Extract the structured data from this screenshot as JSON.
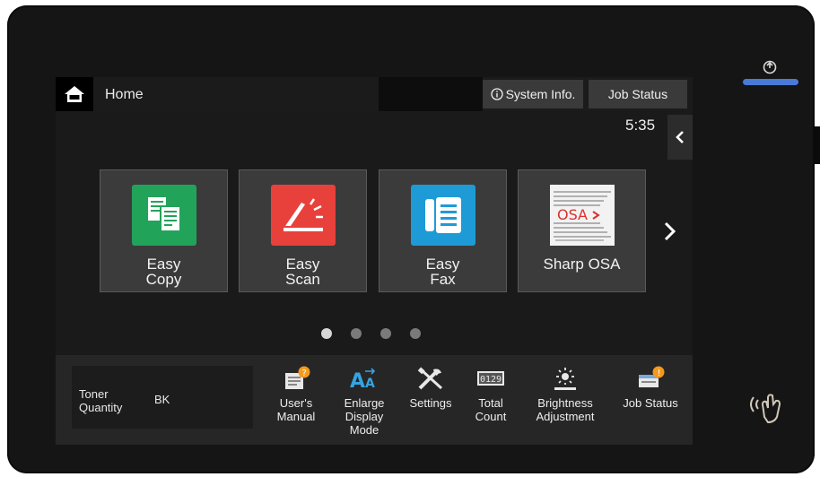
{
  "header": {
    "home_label": "Home",
    "system_info_label": "System Info.",
    "job_status_label": "Job Status",
    "clock": "5:35"
  },
  "tiles": [
    {
      "label_line1": "Easy",
      "label_line2": "Copy",
      "color": "#22a35a",
      "icon": "copy-icon"
    },
    {
      "label_line1": "Easy",
      "label_line2": "Scan",
      "color": "#e8413c",
      "icon": "scan-icon"
    },
    {
      "label_line1": "Easy",
      "label_line2": "Fax",
      "color": "#1e9bd7",
      "icon": "fax-icon"
    },
    {
      "label_line1": "Sharp OSA",
      "label_line2": "",
      "color": "#ffffff",
      "icon": "osa-logo",
      "logo_text": "OSA"
    }
  ],
  "pagination": {
    "pages": 4,
    "current": 1
  },
  "toner": {
    "label_line1": "Toner",
    "label_line2": "Quantity",
    "color_code": "BK"
  },
  "shortcuts": [
    {
      "lines": [
        "User's",
        "Manual"
      ],
      "icon": "manual-icon"
    },
    {
      "lines": [
        "Enlarge",
        "Display",
        "Mode"
      ],
      "icon": "enlarge-text-icon"
    },
    {
      "lines": [
        "Settings"
      ],
      "icon": "settings-icon"
    },
    {
      "lines": [
        "Total",
        "Count"
      ],
      "icon": "counter-icon",
      "counter_text": "0129"
    },
    {
      "lines": [
        "Brightness",
        "Adjustment"
      ],
      "icon": "brightness-icon"
    },
    {
      "lines": [
        "Job Status"
      ],
      "icon": "job-status-icon"
    }
  ],
  "colors": {
    "accent_power": "#4a7ad8",
    "badge_orange": "#f39a1e",
    "enlarge_blue": "#36a3e0"
  }
}
